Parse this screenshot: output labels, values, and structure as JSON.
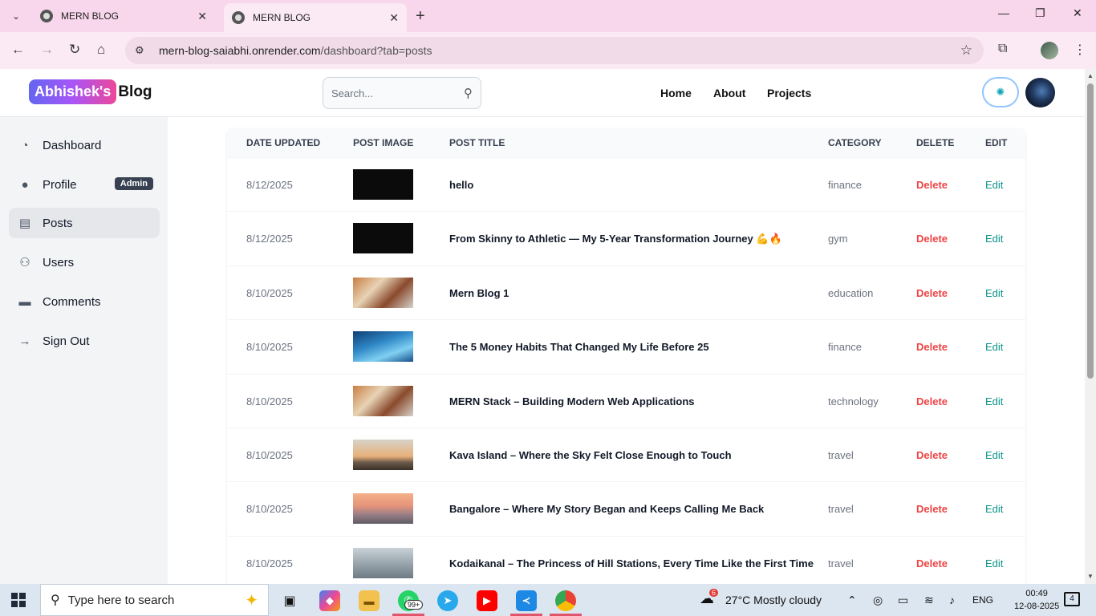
{
  "browser": {
    "tabs": [
      {
        "label": "MERN BLOG",
        "active": false
      },
      {
        "label": "MERN BLOG",
        "active": true
      }
    ],
    "url_host": "mern-blog-saiabhi.onrender.com",
    "url_path": "/dashboard?tab=posts"
  },
  "header": {
    "logo_brand": "Abhishek's",
    "logo_rest": "Blog",
    "search_placeholder": "Search...",
    "nav": [
      "Home",
      "About",
      "Projects"
    ]
  },
  "sidebar": {
    "items": [
      {
        "label": "Dashboard",
        "icon": "pie-chart-icon",
        "glyph": "◔"
      },
      {
        "label": "Profile",
        "icon": "user-icon",
        "glyph": "●",
        "badge": "Admin"
      },
      {
        "label": "Posts",
        "icon": "document-icon",
        "glyph": "▤",
        "active": true
      },
      {
        "label": "Users",
        "icon": "users-icon",
        "glyph": "⚇"
      },
      {
        "label": "Comments",
        "icon": "comment-icon",
        "glyph": "▬"
      },
      {
        "label": "Sign Out",
        "icon": "arrow-right-icon",
        "glyph": "→"
      }
    ]
  },
  "table": {
    "headers": [
      "DATE UPDATED",
      "POST IMAGE",
      "POST TITLE",
      "CATEGORY",
      "DELETE",
      "EDIT"
    ],
    "rows": [
      {
        "date": "8/12/2025",
        "image": "img-dark",
        "title": "hello",
        "category": "finance",
        "delete": "Delete",
        "edit": "Edit"
      },
      {
        "date": "8/12/2025",
        "image": "img-dark",
        "title": "From Skinny to Athletic — My 5-Year Transformation Journey 💪🔥",
        "category": "gym",
        "delete": "Delete",
        "edit": "Edit"
      },
      {
        "date": "8/10/2025",
        "image": "img-desk",
        "title": "Mern Blog 1",
        "category": "education",
        "delete": "Delete",
        "edit": "Edit"
      },
      {
        "date": "8/10/2025",
        "image": "img-stock",
        "title": "The 5 Money Habits That Changed My Life Before 25",
        "category": "finance",
        "delete": "Delete",
        "edit": "Edit"
      },
      {
        "date": "8/10/2025",
        "image": "img-desk",
        "title": "MERN Stack – Building Modern Web Applications",
        "category": "technology",
        "delete": "Delete",
        "edit": "Edit"
      },
      {
        "date": "8/10/2025",
        "image": "img-sky",
        "title": "Kava Island – Where the Sky Felt Close Enough to Touch",
        "category": "travel",
        "delete": "Delete",
        "edit": "Edit"
      },
      {
        "date": "8/10/2025",
        "image": "img-sunset",
        "title": "Bangalore – Where My Story Began and Keeps Calling Me Back",
        "category": "travel",
        "delete": "Delete",
        "edit": "Edit"
      },
      {
        "date": "8/10/2025",
        "image": "img-trees",
        "title": "Kodaikanal – The Princess of Hill Stations, Every Time Like the First Time",
        "category": "travel",
        "delete": "Delete",
        "edit": "Edit"
      }
    ]
  },
  "taskbar": {
    "search_placeholder": "Type here to search",
    "whatsapp_badge": "99+",
    "weather_badge": "6",
    "weather": "27°C  Mostly cloudy",
    "language": "ENG",
    "time": "00:49",
    "date": "12-08-2025",
    "notifications": "4"
  },
  "colors": {
    "delete": "#ef4444",
    "edit": "#0d9488",
    "tabbar": "#f8d7ec"
  }
}
